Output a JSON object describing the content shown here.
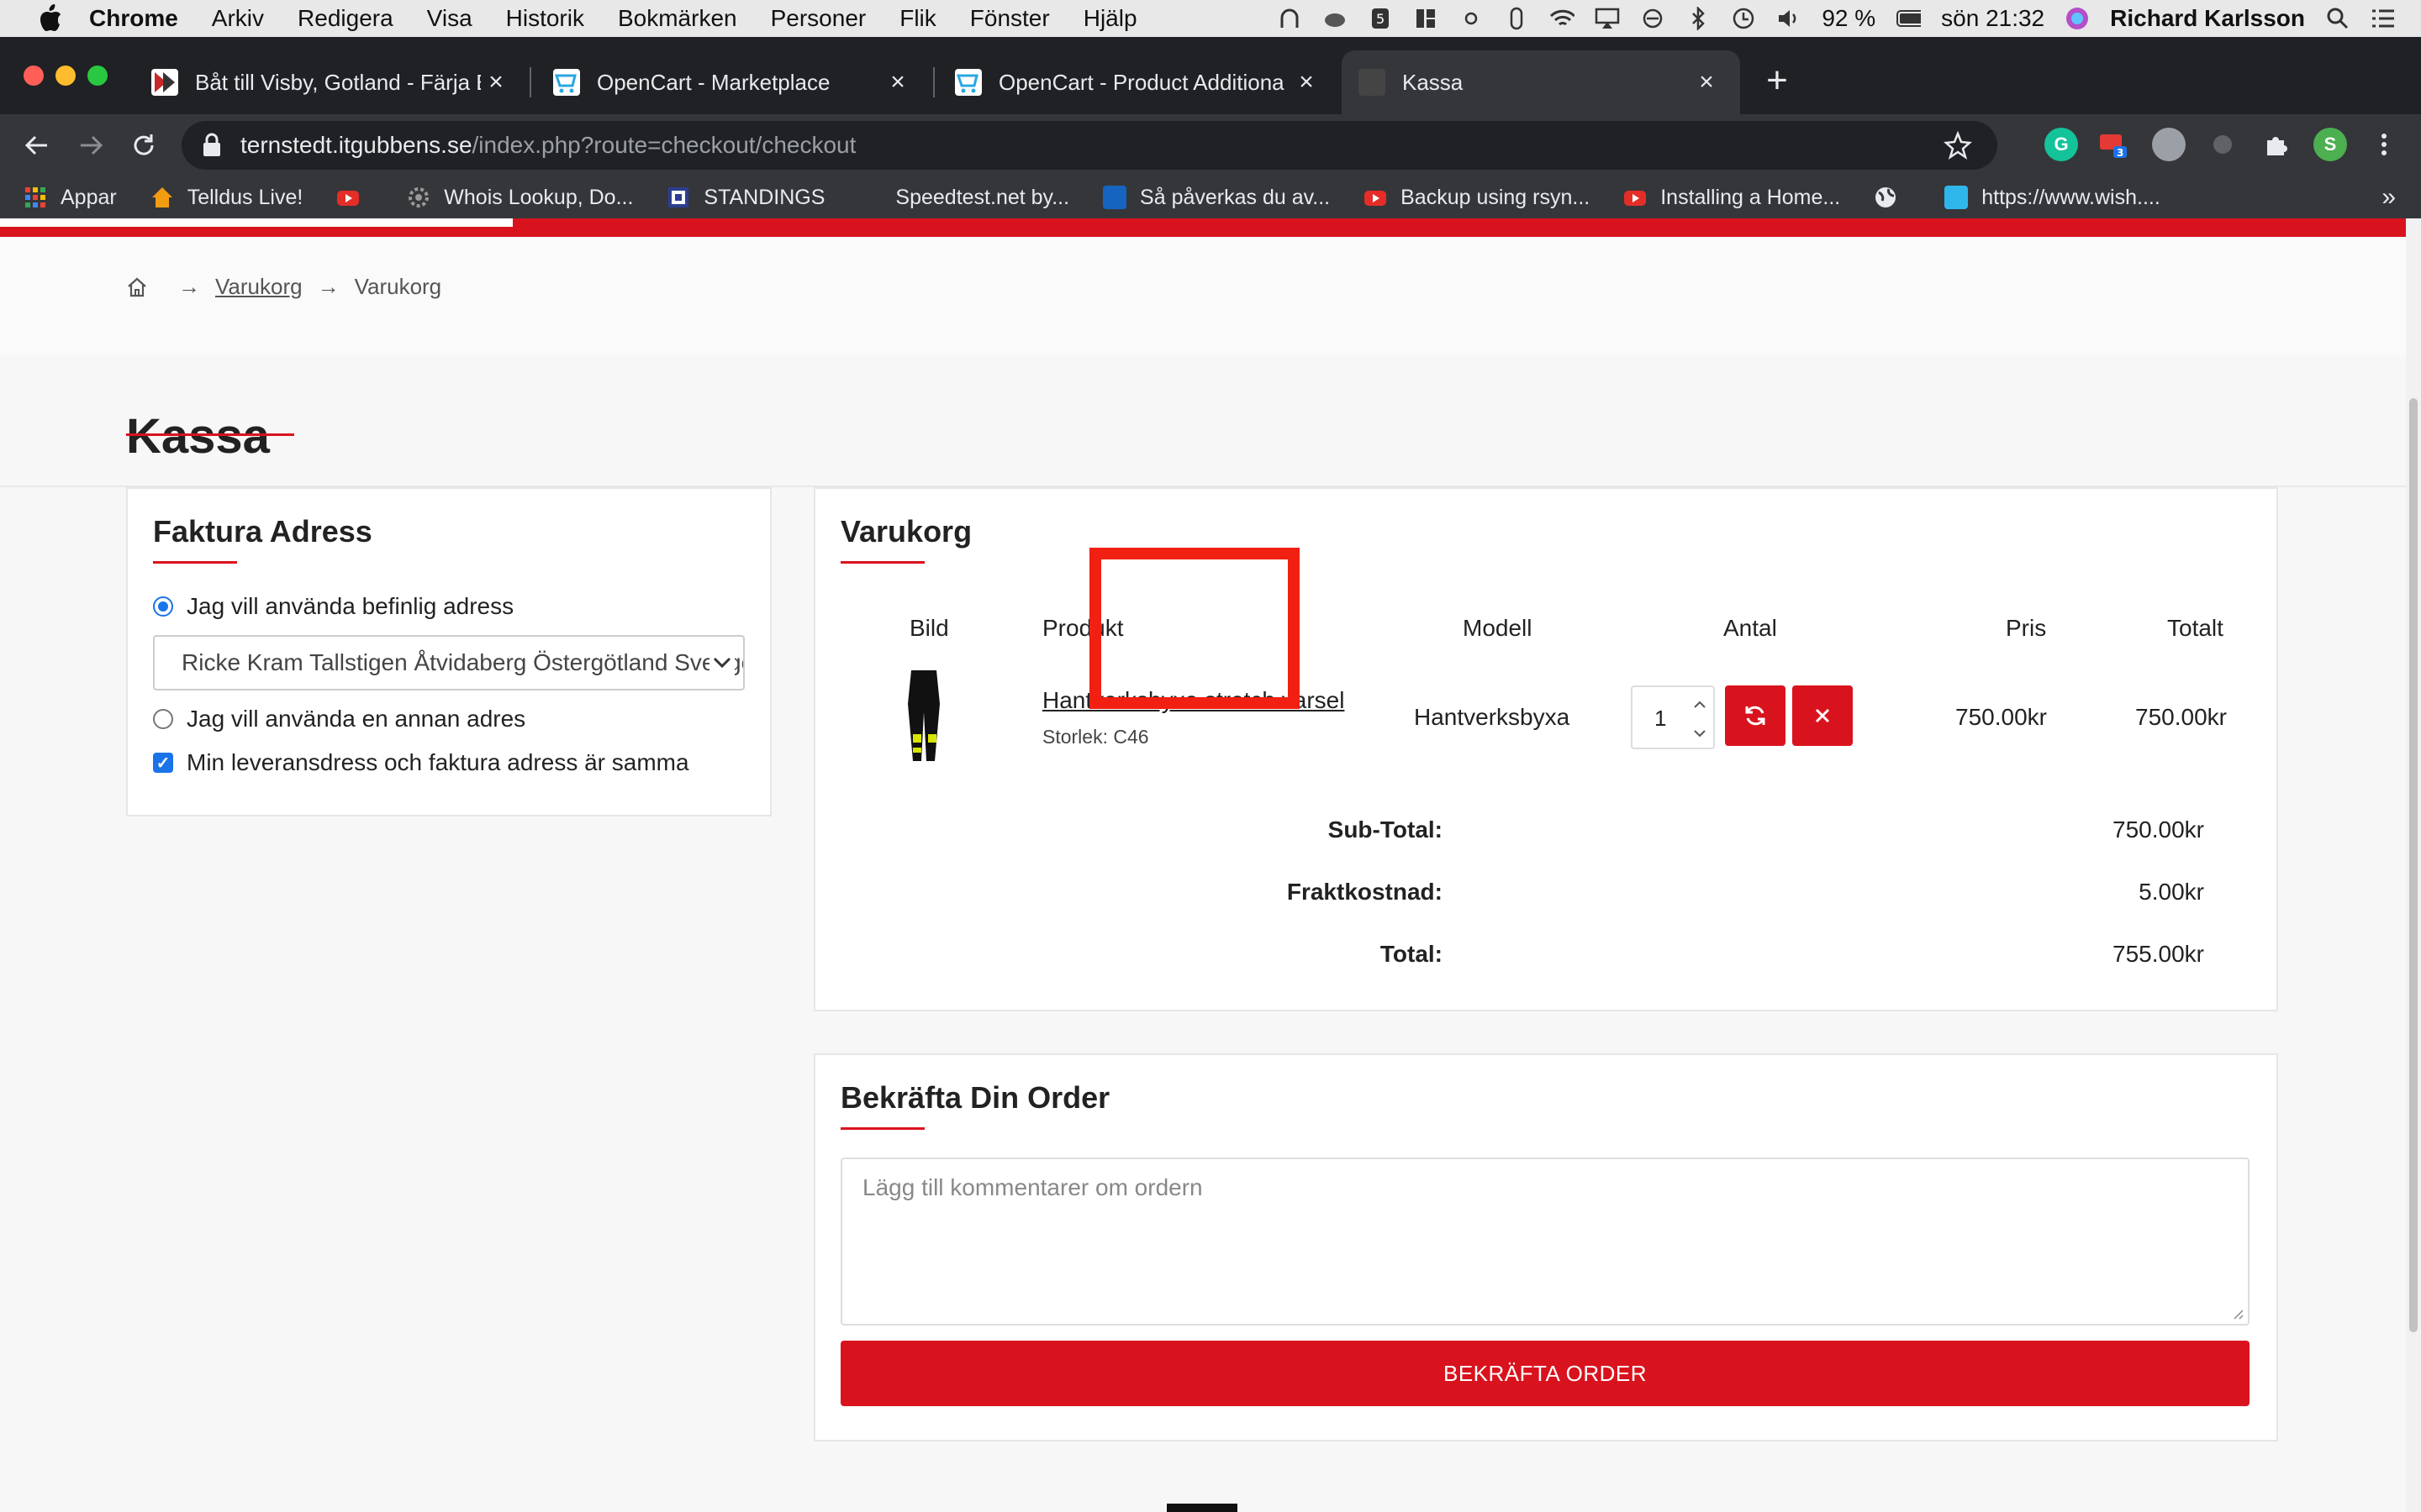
{
  "menubar": {
    "app": "Chrome",
    "items": [
      "Arkiv",
      "Redigera",
      "Visa",
      "Historik",
      "Bokmärken",
      "Personer",
      "Flik",
      "Fönster",
      "Hjälp"
    ],
    "battery": "92 %",
    "clock": "sön 21:32",
    "user": "Richard Karlsson"
  },
  "tabs": [
    {
      "title": "Båt till Visby, Gotland - Färja Båt",
      "color": "#c62828"
    },
    {
      "title": "OpenCart - Marketplace",
      "color": "#2aa7df"
    },
    {
      "title": "OpenCart - Product Additional",
      "color": "#2aa7df"
    },
    {
      "title": "Kassa",
      "color": "#444444"
    }
  ],
  "address": {
    "host": "ternstedt.itgubbens.se",
    "path": "/index.php?route=checkout/checkout"
  },
  "bookmarks": [
    {
      "label": "Appar",
      "color": "#e74c3c"
    },
    {
      "label": "Telldus Live!",
      "color": "#f39c12"
    },
    {
      "label": "",
      "color": "#e52d27"
    },
    {
      "label": "Whois Lookup, Do...",
      "color": "#777777"
    },
    {
      "label": "STANDINGS",
      "color": "#2c3e90"
    },
    {
      "label": "Speedtest.net by...",
      "color": "#35363a"
    },
    {
      "label": "Så påverkas du av...",
      "color": "#1565c0"
    },
    {
      "label": "Backup using rsyn...",
      "color": "#e52d27"
    },
    {
      "label": "Installing a Home...",
      "color": "#e52d27"
    },
    {
      "label": "",
      "color": "#e8eaed"
    },
    {
      "label": "https://www.wish....",
      "color": "#2fb7ec"
    }
  ],
  "bookmarks_more": "»",
  "breadcrumb": {
    "link": "Varukorg",
    "current": "Varukorg"
  },
  "page_title": "Kassa",
  "billing": {
    "heading": "Faktura Adress",
    "option_existing": "Jag vill använda befinlig adress",
    "address_value": "Ricke Kram Tallstigen Åtvidaberg Östergötland Sverige",
    "option_new": "Jag vill använda en annan adres",
    "same_address": "Min leveransdress och faktura adress är samma"
  },
  "cart": {
    "heading": "Varukorg",
    "columns": [
      "Bild",
      "Produkt",
      "Modell",
      "Antal",
      "Pris",
      "Totalt"
    ],
    "item": {
      "name": "Hantverksbyxa stretch varsel",
      "option": "Storlek: C46",
      "model": "Hantverksbyxa",
      "quantity": "1",
      "price": "750.00kr",
      "total": "750.00kr"
    },
    "totals": [
      {
        "label": "Sub-Total:",
        "value": "750.00kr"
      },
      {
        "label": "Fraktkostnad:",
        "value": "5.00kr"
      },
      {
        "label": "Total:",
        "value": "755.00kr"
      }
    ]
  },
  "confirm": {
    "heading": "Bekräfta Din Order",
    "comment_placeholder": "Lägg till kommentarer om ordern",
    "button": "BEKRÄFTA ORDER"
  },
  "colors": {
    "accent": "#d9131e",
    "annotation": "#f22013"
  }
}
